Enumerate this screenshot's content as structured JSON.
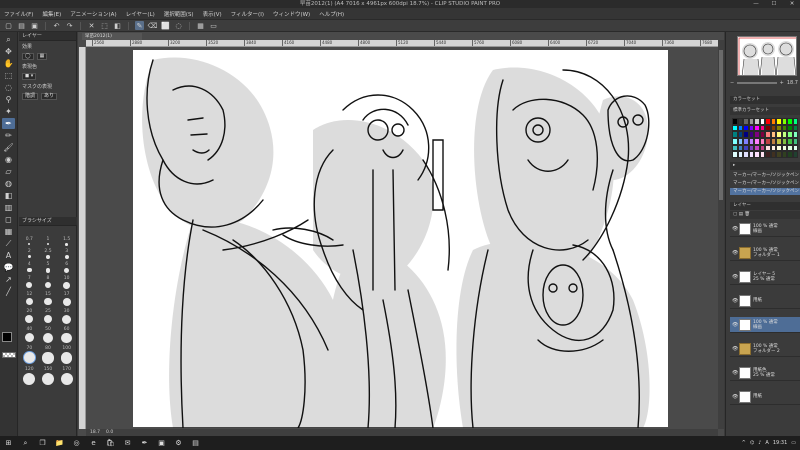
{
  "window": {
    "title": "早苗2012(1) (A4 7016 x 4961px 600dpi 18.7%) - CLIP STUDIO PAINT PRO",
    "controls": {
      "minimize": "—",
      "maximize": "☐",
      "close": "✕"
    }
  },
  "menu": [
    "ファイル(F)",
    "編集(E)",
    "アニメーション(A)",
    "レイヤー(L)",
    "選択範囲(S)",
    "表示(V)",
    "フィルター(I)",
    "ウィンドウ(W)",
    "ヘルプ(H)"
  ],
  "toolbar": {
    "icons": [
      "new-icon",
      "open-icon",
      "save-icon",
      "undo-icon",
      "redo-icon",
      "clear-icon",
      "transform-icon",
      "pen-icon",
      "eraser-icon",
      "select-icon",
      "fill-icon"
    ]
  },
  "tools": [
    "magnify-icon",
    "move-icon",
    "hand-icon",
    "select-icon",
    "lasso-icon",
    "eyedropper-icon",
    "pen-icon",
    "pencil-icon",
    "brush-icon",
    "airbrush-icon",
    "eraser-icon",
    "blend-icon",
    "fill-icon",
    "gradient-icon",
    "figure-icon",
    "frame-icon",
    "text-icon",
    "balloon-icon",
    "ruler-icon",
    "correct-icon"
  ],
  "subtool_panel": {
    "tab_label": "レイヤー",
    "effect_label": "効果",
    "expression_label": "表現色",
    "mask_label": "マスクの表現",
    "mask_value": "階調",
    "mask_option": "あり",
    "brush_tab": "ブラシサイズ"
  },
  "brush_sizes": [
    "0.7",
    "1",
    "1.5",
    "2",
    "2.5",
    "3",
    "4",
    "5",
    "6",
    "7",
    "8",
    "10",
    "12",
    "15",
    "17",
    "20",
    "25",
    "30",
    "40",
    "50",
    "60",
    "70",
    "80",
    "100",
    "120",
    "150",
    "170"
  ],
  "document": {
    "tab": "早苗2012(1)",
    "ruler_labels": [
      "2560",
      "2880",
      "3200",
      "3520",
      "3840",
      "4160",
      "4480",
      "4800",
      "5120",
      "5440",
      "5760",
      "6080",
      "6400",
      "6720",
      "7040",
      "7360",
      "7680"
    ],
    "zoom": "18.7",
    "angle": "0.0"
  },
  "right_panel": {
    "nav_zoom": "18.7",
    "color_section": "カラーセット",
    "color_set_label": "標準カラーセット",
    "sets": [
      "マーカー/マーカー/ソジックペン",
      "マーカー/マーカー/ソジックペン",
      "マーカー/マーカー/ソジックペン"
    ],
    "layer_section": "レイヤー",
    "layers": [
      {
        "name": "線画",
        "sub": "100 % 通常",
        "type": "image",
        "selected": false
      },
      {
        "name": "フォルダー 1",
        "sub": "100 % 通常",
        "type": "folder",
        "selected": false
      },
      {
        "name": "25 % 通常",
        "sub": "レイヤー 5",
        "type": "image",
        "selected": false
      },
      {
        "name": "用紙",
        "sub": "",
        "type": "image",
        "selected": false
      },
      {
        "name": "線画",
        "sub": "100 % 通常",
        "type": "image",
        "selected": true
      },
      {
        "name": "フォルダー 2",
        "sub": "100 % 通常",
        "type": "folder",
        "selected": false
      },
      {
        "name": "25 % 通常",
        "sub": "用紙色",
        "type": "image",
        "selected": false
      },
      {
        "name": "用紙",
        "sub": "",
        "type": "image",
        "selected": false
      }
    ]
  },
  "palette_colors": [
    "#000000",
    "#333333",
    "#666666",
    "#999999",
    "#cccccc",
    "#ffffff",
    "#ff0000",
    "#ff8000",
    "#ffff00",
    "#80ff00",
    "#00ff00",
    "#00ff80",
    "#00ffff",
    "#0080ff",
    "#0000ff",
    "#8000ff",
    "#ff00ff",
    "#ff0080",
    "#800000",
    "#804000",
    "#808000",
    "#408000",
    "#008000",
    "#008040",
    "#008080",
    "#004080",
    "#000080",
    "#400080",
    "#800080",
    "#800040",
    "#ff8080",
    "#ffc080",
    "#ffff80",
    "#c0ff80",
    "#80ff80",
    "#80ffc0",
    "#80ffff",
    "#80c0ff",
    "#8080ff",
    "#c080ff",
    "#ff80ff",
    "#ff80c0",
    "#c04040",
    "#c08040",
    "#c0c040",
    "#80c040",
    "#40c040",
    "#40c080",
    "#40c0c0",
    "#4080c0",
    "#4040c0",
    "#8040c0",
    "#c040c0",
    "#c04080",
    "#ffe0e0",
    "#fff0e0",
    "#ffffe0",
    "#f0ffe0",
    "#e0ffe0",
    "#e0fff0",
    "#e0ffff",
    "#e0f0ff",
    "#e0e0ff",
    "#f0e0ff",
    "#ffe0ff",
    "#ffe0f0",
    "#402020",
    "#403020",
    "#404020",
    "#304020",
    "#204020",
    "#204030"
  ],
  "taskbar": {
    "apps": [
      "windows-icon",
      "search-icon",
      "taskview-icon",
      "explorer-icon",
      "chrome-icon",
      "edge-icon",
      "store-icon",
      "mail-icon",
      "csp-icon",
      "photos-icon",
      "settings-icon",
      "folder-icon"
    ],
    "time": "19:31",
    "ime": "A"
  }
}
